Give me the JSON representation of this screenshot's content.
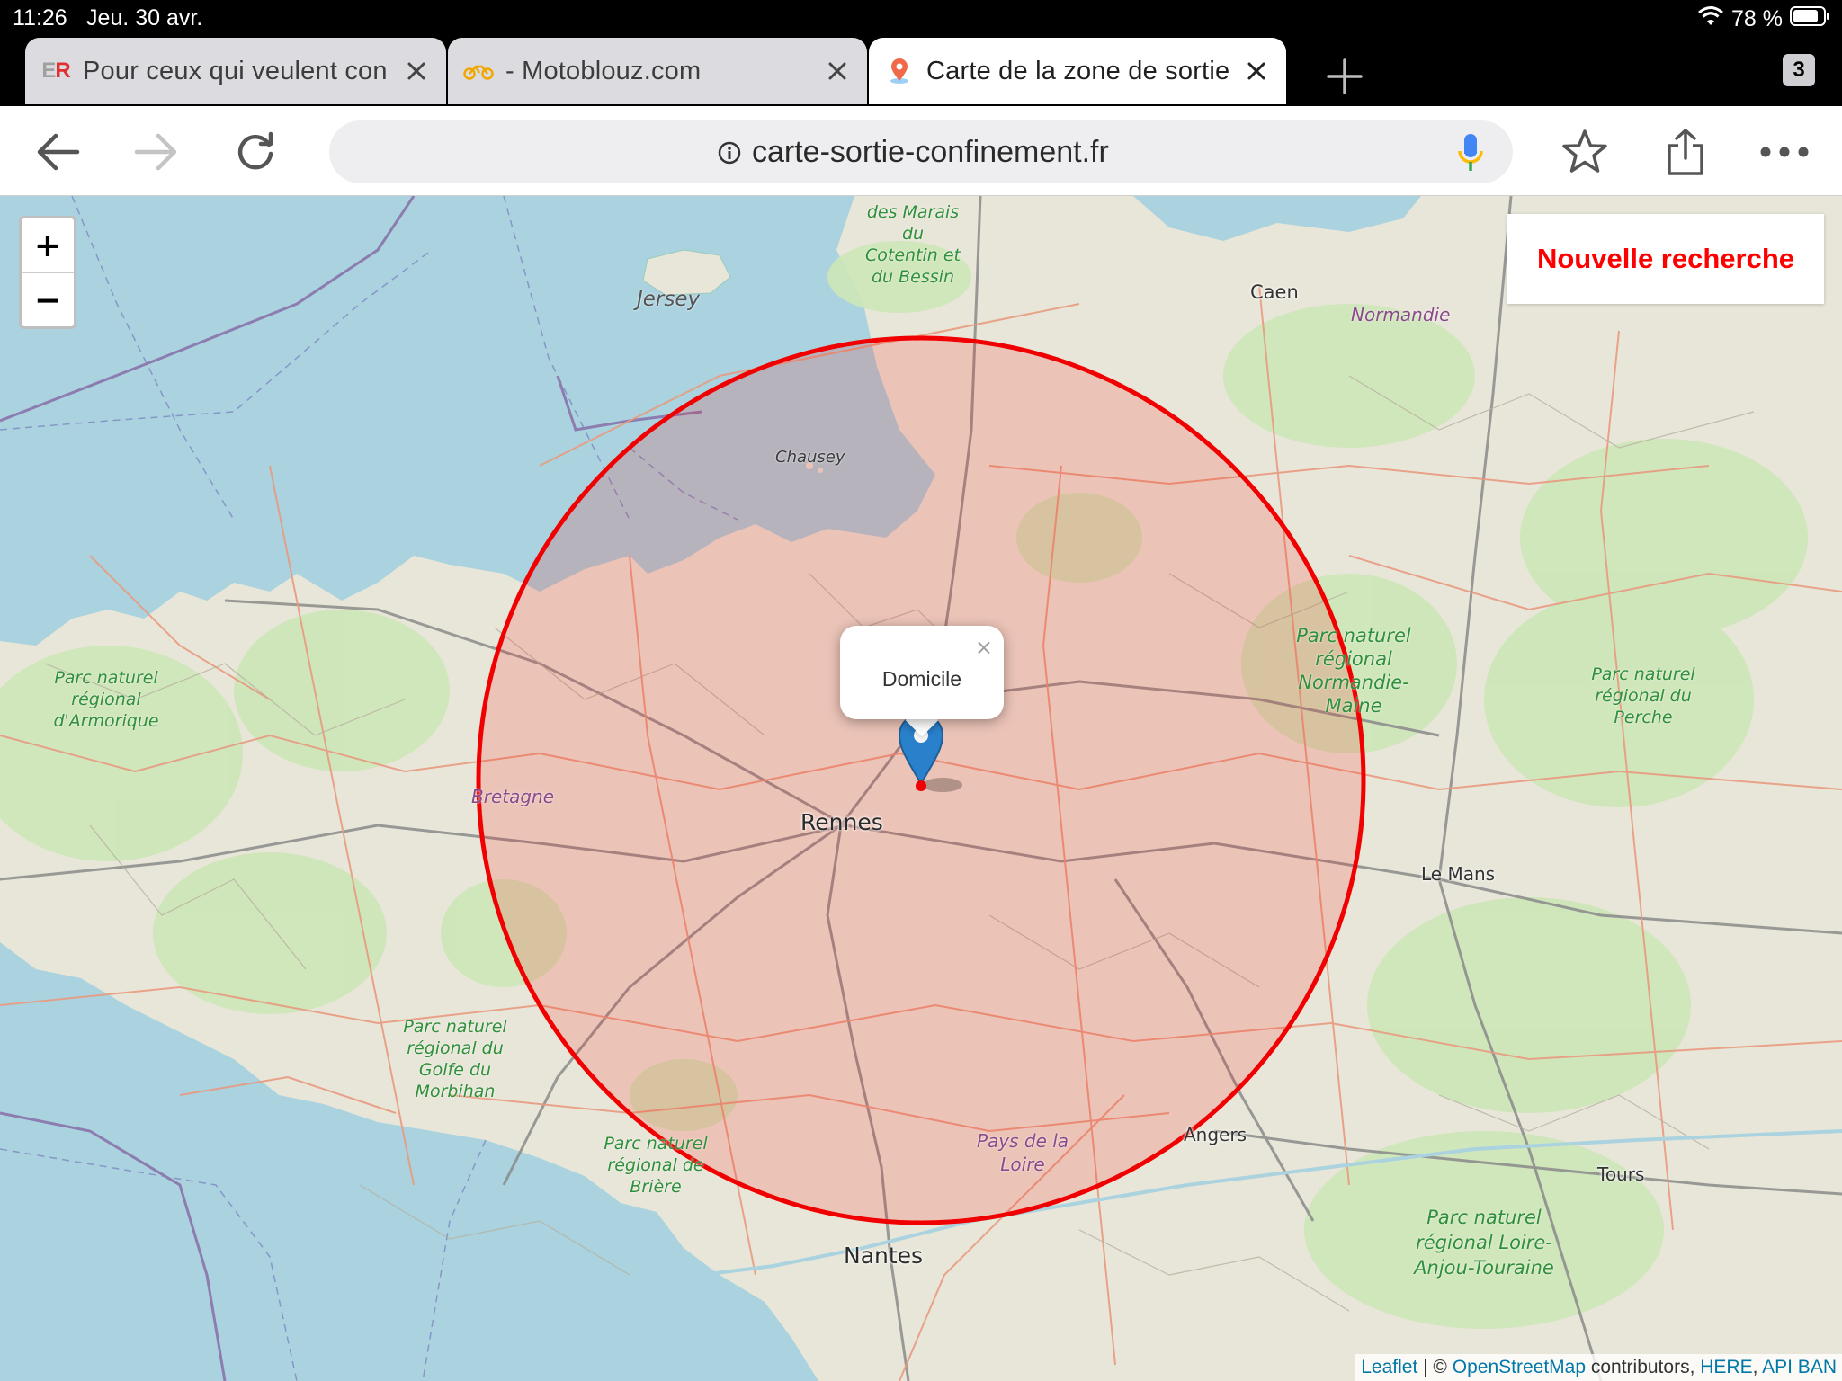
{
  "status_bar": {
    "time": "11:26",
    "date": "Jeu. 30 avr.",
    "battery": "78 %"
  },
  "tabs": [
    {
      "title": "Pour ceux qui veulent con",
      "icon_text": "ER",
      "icon": "er-favicon",
      "active": false
    },
    {
      "title": "- Motoblouz.com",
      "icon": "motorcycle-favicon",
      "active": false
    },
    {
      "title": "Carte de la zone de sortie",
      "icon": "map-pin-favicon",
      "active": true
    }
  ],
  "tab_count": "3",
  "address_bar": {
    "url": "carte-sortie-confinement.fr"
  },
  "map": {
    "search_button_label": "Nouvelle recherche",
    "zoom_in_label": "+",
    "zoom_out_label": "−",
    "popup_text": "Domicile",
    "popup_close": "×",
    "zone_color": "#ff0000",
    "labels": {
      "jersey": "Jersey",
      "chausey": "Chausey",
      "caen": "Caen",
      "normandie": "Normandie",
      "bretagne": "Bretagne",
      "rennes": "Rennes",
      "le_mans": "Le Mans",
      "angers": "Angers",
      "tours": "Tours",
      "nantes": "Nantes",
      "pays_de_la_loire": "Pays de la Loire",
      "marais": "des Marais du Cotentin et du Bessin",
      "armorique": "Parc naturel régional d'Armorique",
      "normandie_maine": "Parc naturel régional Normandie-Maine",
      "perche": "Parc naturel régional du Perche",
      "morbihan": "Parc naturel régional du Golfe du Morbihan",
      "briere": "Parc naturel régional de Brière",
      "loire_anjou": "Parc naturel régional Loire-Anjou-Touraine"
    },
    "attribution": {
      "leaflet": "Leaflet",
      "sep": " | © ",
      "osm": "OpenStreetMap",
      "contributors": " contributors, ",
      "here": "HERE",
      "comma": ", ",
      "api_ban": "API BAN"
    }
  }
}
